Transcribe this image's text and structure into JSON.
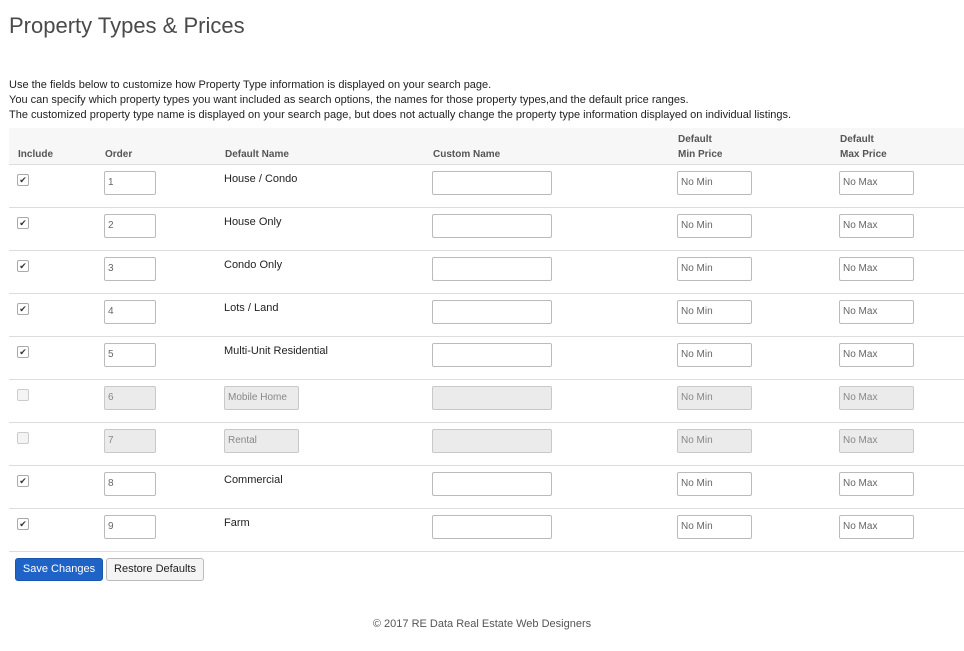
{
  "page": {
    "title": "Property Types & Prices",
    "description": [
      "Use the fields below to customize how Property Type information is displayed on your search page.",
      "You can specify which property types you want included as search options, the names for those property types,and the default price ranges.",
      "The customized property type name is displayed on your search page, but does not actually change the property type information displayed on individual listings."
    ]
  },
  "table": {
    "headers": {
      "include": "Include",
      "order": "Order",
      "default_name": "Default Name",
      "custom_name": "Custom Name",
      "min_price_line1": "Default",
      "min_price_line2": "Min Price",
      "max_price_line1": "Default",
      "max_price_line2": "Max Price"
    },
    "rows": [
      {
        "included": true,
        "order": "1",
        "default_name": "House / Condo",
        "custom_name": "",
        "min_placeholder": "No Min",
        "max_placeholder": "No Max"
      },
      {
        "included": true,
        "order": "2",
        "default_name": "House Only",
        "custom_name": "",
        "min_placeholder": "No Min",
        "max_placeholder": "No Max"
      },
      {
        "included": true,
        "order": "3",
        "default_name": "Condo Only",
        "custom_name": "",
        "min_placeholder": "No Min",
        "max_placeholder": "No Max"
      },
      {
        "included": true,
        "order": "4",
        "default_name": "Lots / Land",
        "custom_name": "",
        "min_placeholder": "No Min",
        "max_placeholder": "No Max"
      },
      {
        "included": true,
        "order": "5",
        "default_name": "Multi-Unit Residential",
        "custom_name": "",
        "min_placeholder": "No Min",
        "max_placeholder": "No Max"
      },
      {
        "included": false,
        "order": "6",
        "default_name": "Mobile Home",
        "custom_name": "",
        "min_placeholder": "No Min",
        "max_placeholder": "No Max"
      },
      {
        "included": false,
        "order": "7",
        "default_name": "Rental",
        "custom_name": "",
        "min_placeholder": "No Min",
        "max_placeholder": "No Max"
      },
      {
        "included": true,
        "order": "8",
        "default_name": "Commercial",
        "custom_name": "",
        "min_placeholder": "No Min",
        "max_placeholder": "No Max"
      },
      {
        "included": true,
        "order": "9",
        "default_name": "Farm",
        "custom_name": "",
        "min_placeholder": "No Min",
        "max_placeholder": "No Max"
      }
    ]
  },
  "buttons": {
    "save": "Save Changes",
    "restore": "Restore Defaults"
  },
  "footer": {
    "text": "© 2017 RE Data Real Estate Web Designers"
  },
  "colors": {
    "save_button": "#1f63c6"
  }
}
